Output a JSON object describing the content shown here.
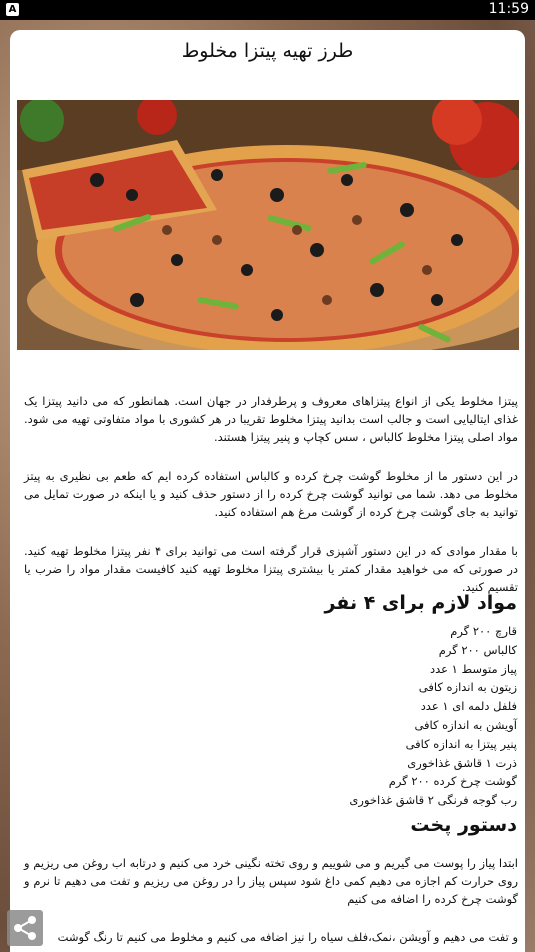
{
  "status_bar": {
    "app_badge": "A",
    "time": "11:59"
  },
  "article": {
    "title": "طرز تهیه پیتزا مخلوط",
    "paragraphs": [
      "پیتزا مخلوط یکی از انواع پیتزاهای معروف و پرطرفدار در جهان است. همانطور که می دانید پیتزا یک غذای ایتالیایی است و جالب است بدانید پیتزا مخلوط تقریبا در هر کشوری با مواد متفاوتی تهیه می شود. مواد اصلی پیتزا مخلوط کالباس ، سس کچاپ و پنیر پیتزا هستند.",
      "در این دستور ما از مخلوط گوشت چرخ کرده و کالباس استفاده کرده ایم که طعم بی نظیری به پیتز مخلوط می دهد. شما می توانید گوشت چرخ کرده را از دستور حذف کنید و یا اینکه در صورت تمایل می توانید به جای گوشت چرخ کرده از گوشت مرغ هم استفاده کنید.",
      "با مقدار موادی که در این دستور آشپزی قرار گرفته است می توانید برای ۴ نفر پیتزا مخلوط تهیه کنید. در صورتی که می خواهید مقدار کمتر یا بیشتری پیتزا مخلوط تهیه کنید کافیست مقدار مواد را ضرب یا تقسیم کنید."
    ],
    "ingredients_heading": "مواد لازم برای ۴ نفر",
    "ingredients": [
      "قارچ ۲۰۰ گرم",
      "کالباس ۲۰۰ گرم",
      "پیاز متوسط ۱ عدد",
      "زیتون به اندازه کافی",
      "فلفل دلمه ای ۱ عدد",
      "آویشن به اندازه کافی",
      "پنیر پیتزا به اندازه کافی",
      "ذرت ۱ قاشق غذاخوری",
      "گوشت چرخ کرده ۲۰۰ گرم",
      "رب گوجه فرنگی ۲ قاشق غذاخوری"
    ],
    "steps_heading": "دستور پخت",
    "steps": [
      "ابتدا پیاز را پوست می گیریم و می شوییم و روی تخته نگینی خرد می کنیم و درتابه اب روغن می ریزیم و روی حرارت کم اجازه می دهیم کمی داغ شود سپس پیاز را در روغن می ریزیم و تفت می دهیم تا نرم و گوشت چرخ کرده را اضافه می کنیم",
      "و تفت می دهیم و آویشن ،نمک،فلف سیاه را نیز اضافه می کنیم و مخلوط می کنیم تا رنگ گوشت"
    ]
  },
  "colors": {
    "status_bar": "#000000",
    "card": "#ffffff",
    "text": "#111111"
  },
  "icons": {
    "share": "share-icon"
  }
}
